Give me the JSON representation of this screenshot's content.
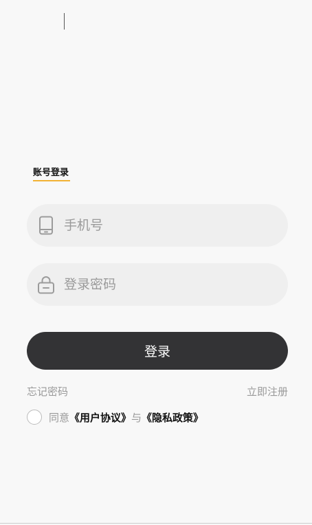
{
  "tabs": {
    "account_login": "账号登录"
  },
  "phone_field": {
    "placeholder": "手机号",
    "icon": "phone-icon"
  },
  "password_field": {
    "placeholder": "登录密码",
    "icon": "lock-icon"
  },
  "login_button": {
    "label": "登录"
  },
  "links": {
    "forgot_password": "忘记密码",
    "register": "立即注册"
  },
  "agreement": {
    "prefix": "同意",
    "user_agreement": "《用户协议》",
    "connector": "与",
    "privacy_policy": "《隐私政策》"
  },
  "colors": {
    "accent": "#f2b233",
    "button_bg": "#333335",
    "field_bg": "#efefef"
  }
}
